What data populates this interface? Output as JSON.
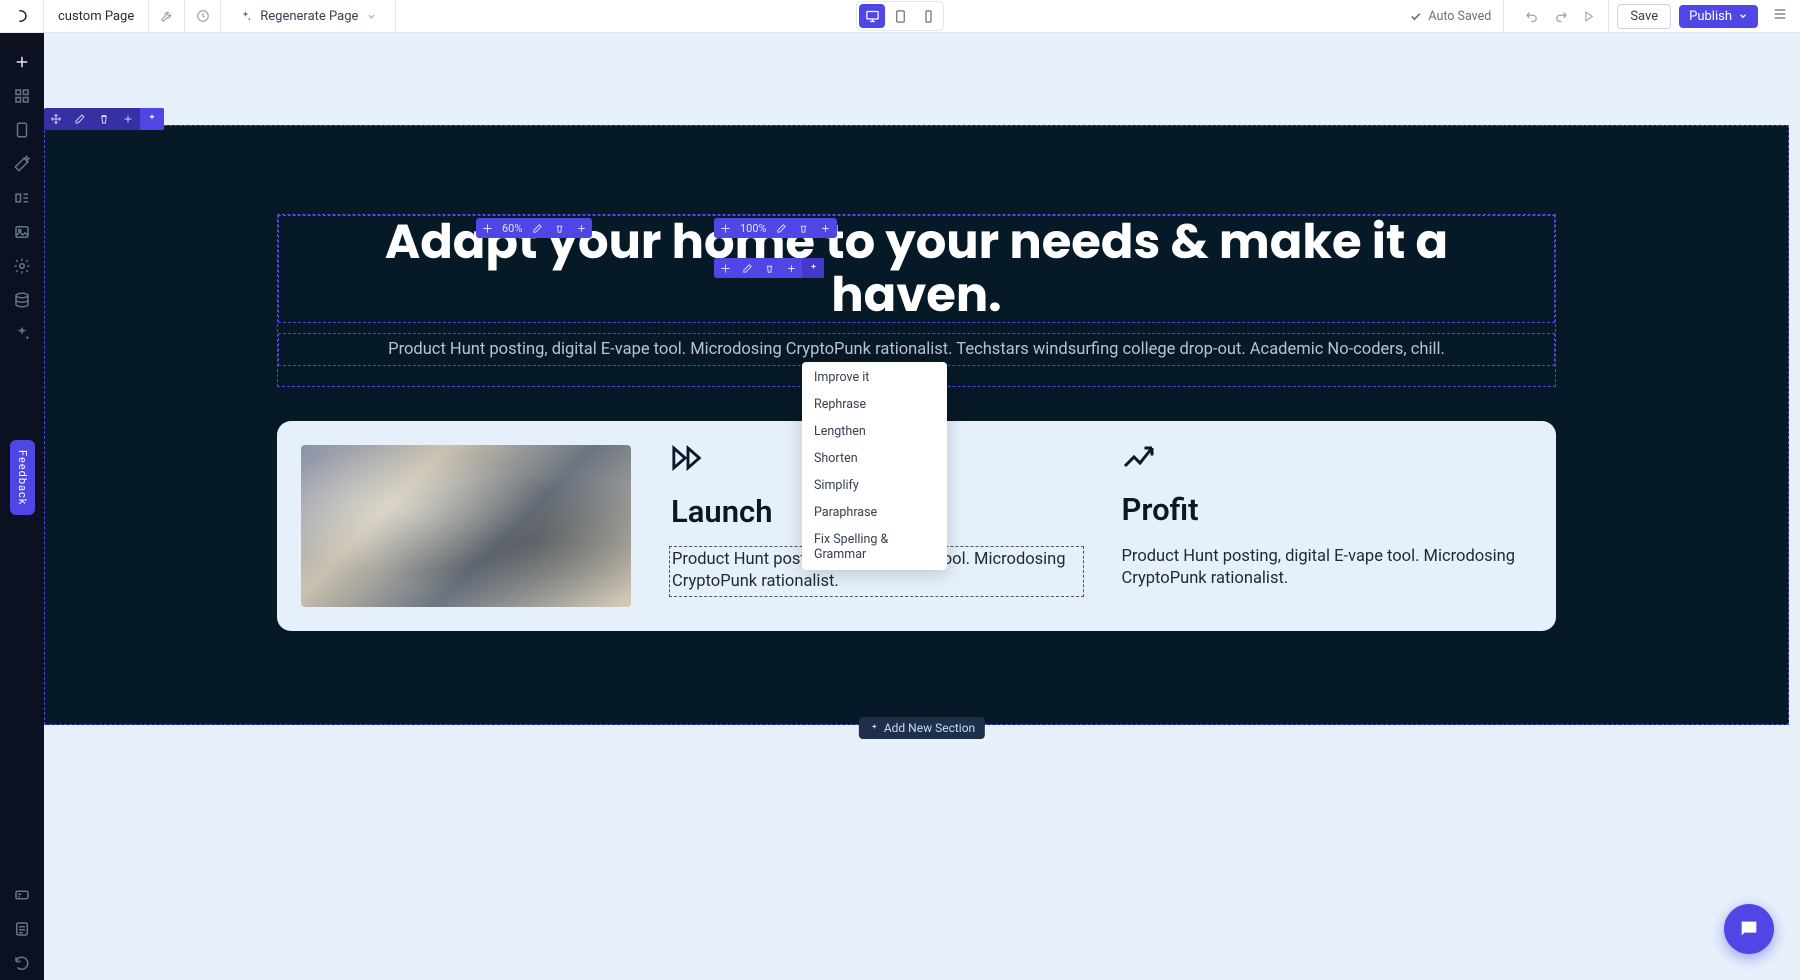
{
  "topbar": {
    "page_name": "custom Page",
    "regenerate": "Regenerate Page",
    "auto_saved": "Auto Saved",
    "save": "Save",
    "publish": "Publish"
  },
  "feedback_label": "Feedback",
  "section_toolbar": {},
  "col1": {
    "pct": "60%"
  },
  "col2": {
    "pct": "100%"
  },
  "hero": {
    "heading": "Adapt your home to your needs & make it a haven.",
    "subhead": "Product Hunt posting, digital E-vape tool. Microdosing CryptoPunk rationalist. Techstars windsurfing college drop-out. Academic No-coders, chill."
  },
  "ai_menu": [
    "Improve it",
    "Rephrase",
    "Lengthen",
    "Shorten",
    "Simplify",
    "Paraphrase",
    "Fix Spelling & Grammar"
  ],
  "cards": {
    "launch": {
      "title": "Launch",
      "text": "Product Hunt posting, digital E-vape tool. Microdosing CryptoPunk rationalist."
    },
    "profit": {
      "title": "Profit",
      "text": "Product Hunt posting, digital E-vape tool. Microdosing CryptoPunk rationalist."
    }
  },
  "add_section": "Add New Section"
}
